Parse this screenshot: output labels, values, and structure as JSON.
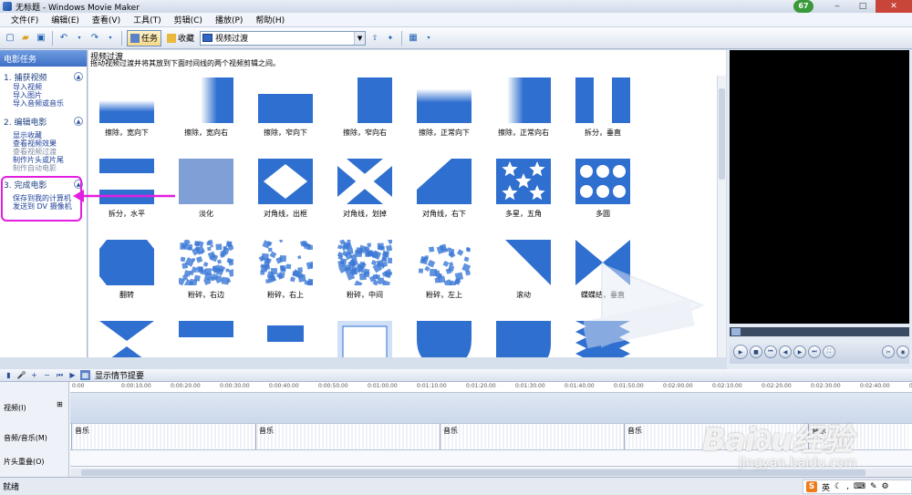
{
  "window": {
    "title": "无标题 - Windows Movie Maker",
    "badge": "67"
  },
  "menu": [
    "文件(F)",
    "编辑(E)",
    "查看(V)",
    "工具(T)",
    "剪辑(C)",
    "播放(P)",
    "帮助(H)"
  ],
  "toolbar": {
    "tasks_label": "任务",
    "collections_label": "收藏",
    "collection_value": "视频过渡"
  },
  "taskpane": {
    "header": "电影任务",
    "sections": [
      {
        "title": "1. 捕获视频",
        "items": [
          "导入视频",
          "导入图片",
          "导入音频或音乐"
        ]
      },
      {
        "title": "2. 编辑电影",
        "items": [
          "显示收藏",
          "查看视频效果",
          "查看视频过渡",
          "制作片头或片尾",
          "制作自动电影"
        ]
      },
      {
        "title": "3. 完成电影",
        "items": [
          "保存到我的计算机",
          "发送到 DV 摄像机"
        ]
      }
    ]
  },
  "content": {
    "title": "视频过渡",
    "description": "拖动视频过渡并将其放到下面时间线的两个视频剪辑之间。",
    "transitions": [
      "擦除，宽向下",
      "擦除，宽向右",
      "擦除，窄向下",
      "擦除，窄向右",
      "擦除，正常向下",
      "擦除，正常向右",
      "拆分，垂直",
      "拆分，水平",
      "淡化",
      "对角线，出框",
      "对角线，划掉",
      "对角线，右下",
      "多星，五角",
      "多圆",
      "翻转",
      "粉碎，右边",
      "粉碎，右上",
      "粉碎，中间",
      "粉碎，左上",
      "滚动",
      "蝶蝶结，垂直",
      "",
      "",
      "",
      "",
      "",
      "",
      ""
    ]
  },
  "storyboard": {
    "toggle_label": "显示情节提要"
  },
  "timeline": {
    "tracks": {
      "video": "视频(I)",
      "audio": "音频/音乐(M)",
      "title": "片头重叠(O)"
    },
    "audio_clips": [
      "音乐",
      "音乐",
      "音乐",
      "音乐",
      "音乐"
    ],
    "ruler": [
      "0:00",
      "0:00:10.00",
      "0:00:20.00",
      "0:00:30.00",
      "0:00:40.00",
      "0:00:50.00",
      "0:01:00.00",
      "0:01:10.00",
      "0:01:20.00",
      "0:01:30.00",
      "0:01:40.00",
      "0:01:50.00",
      "0:02:00.00",
      "0:02:10.00",
      "0:02:20.00",
      "0:02:30.00",
      "0:02:40.00",
      "0:02:50.00"
    ]
  },
  "status": {
    "text": "就绪",
    "ime_lang": "英",
    "ime_logo": "S"
  },
  "watermark": {
    "brand": "Bai∂u经验",
    "url": "jingyan.baidu.com"
  }
}
